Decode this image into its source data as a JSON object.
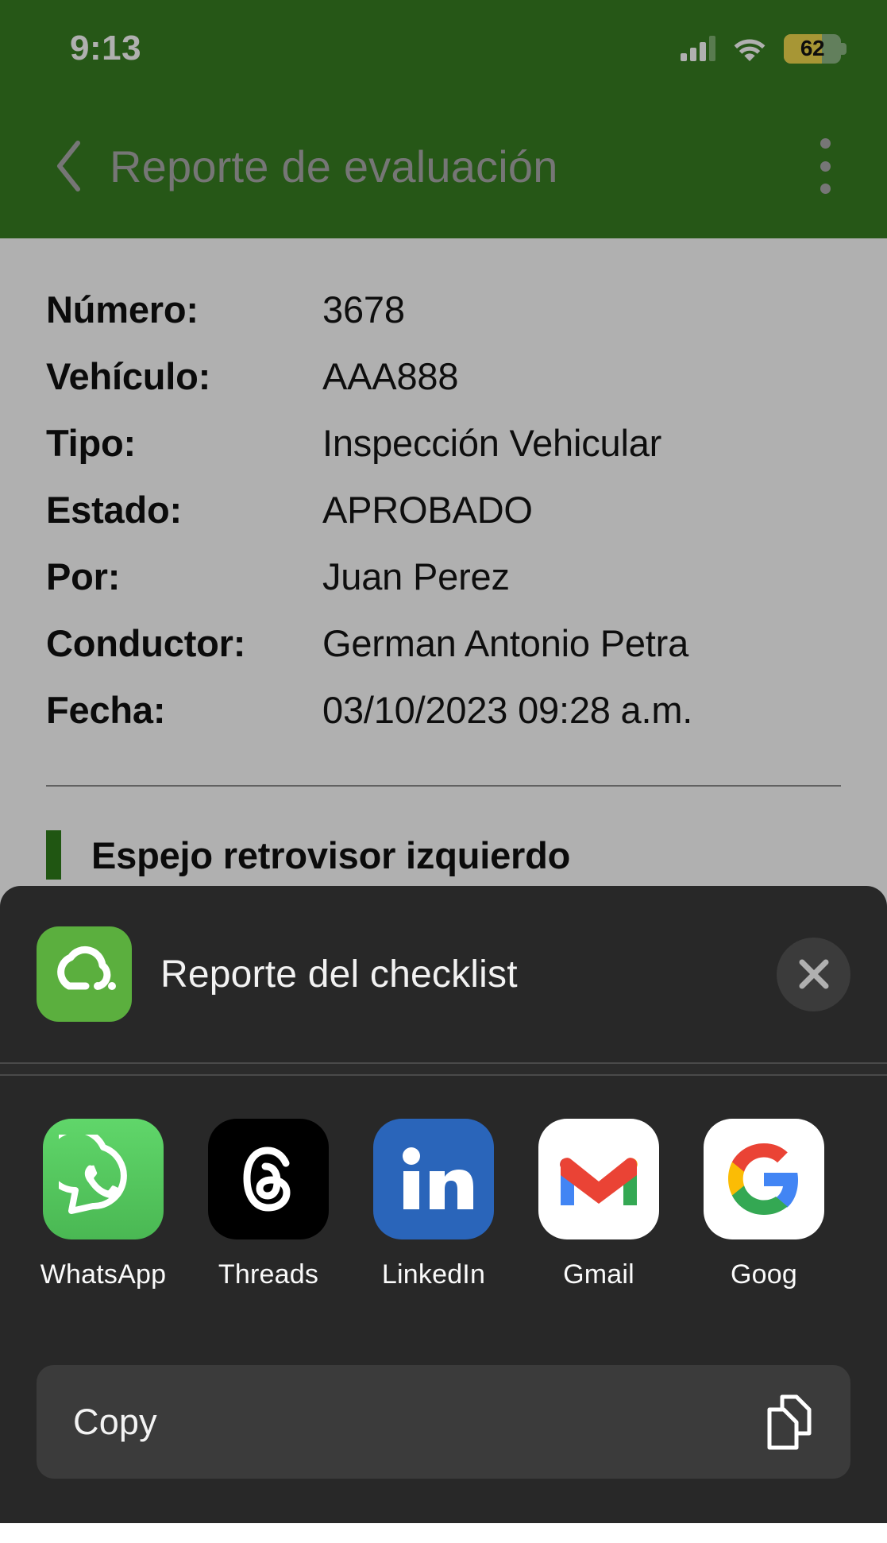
{
  "status_bar": {
    "time": "9:13",
    "signal_icon": "signal-bars-icon",
    "wifi_icon": "wifi-icon",
    "battery_icon": "battery-saver-icon",
    "battery_level": "62"
  },
  "app_bar": {
    "back_icon": "chevron-left-icon",
    "title": "Reporte de evaluación",
    "overflow_icon": "more-vertical-icon",
    "background_color": "#377F22",
    "title_color": "#ACACAC"
  },
  "report": {
    "rows": [
      {
        "label": "Número:",
        "value": "3678"
      },
      {
        "label": "Vehículo:",
        "value": "AAA888"
      },
      {
        "label": "Tipo:",
        "value": "Inspección Vehicular"
      },
      {
        "label": "Estado:",
        "value": "APROBADO"
      },
      {
        "label": "Por:",
        "value": "Juan Perez"
      },
      {
        "label": "Conductor:",
        "value": "German Antonio Petra"
      },
      {
        "label": "Fecha:",
        "value": "03/10/2023 09:28 a.m."
      }
    ],
    "checklist": [
      {
        "label": "Espejo retrovisor izquierdo",
        "accent_color": "#2F7D1B"
      }
    ]
  },
  "share_sheet": {
    "app_icon": "cloud-checklist-app-icon",
    "title": "Reporte del checklist",
    "close_icon": "close-icon",
    "targets": [
      {
        "name": "WhatsApp",
        "icon": "whatsapp-icon"
      },
      {
        "name": "Threads",
        "icon": "threads-icon"
      },
      {
        "name": "LinkedIn",
        "icon": "linkedin-icon"
      },
      {
        "name": "Gmail",
        "icon": "gmail-icon"
      },
      {
        "name": "Goog",
        "icon": "google-icon"
      }
    ],
    "copy": {
      "label": "Copy",
      "icon": "copy-documents-icon"
    }
  }
}
